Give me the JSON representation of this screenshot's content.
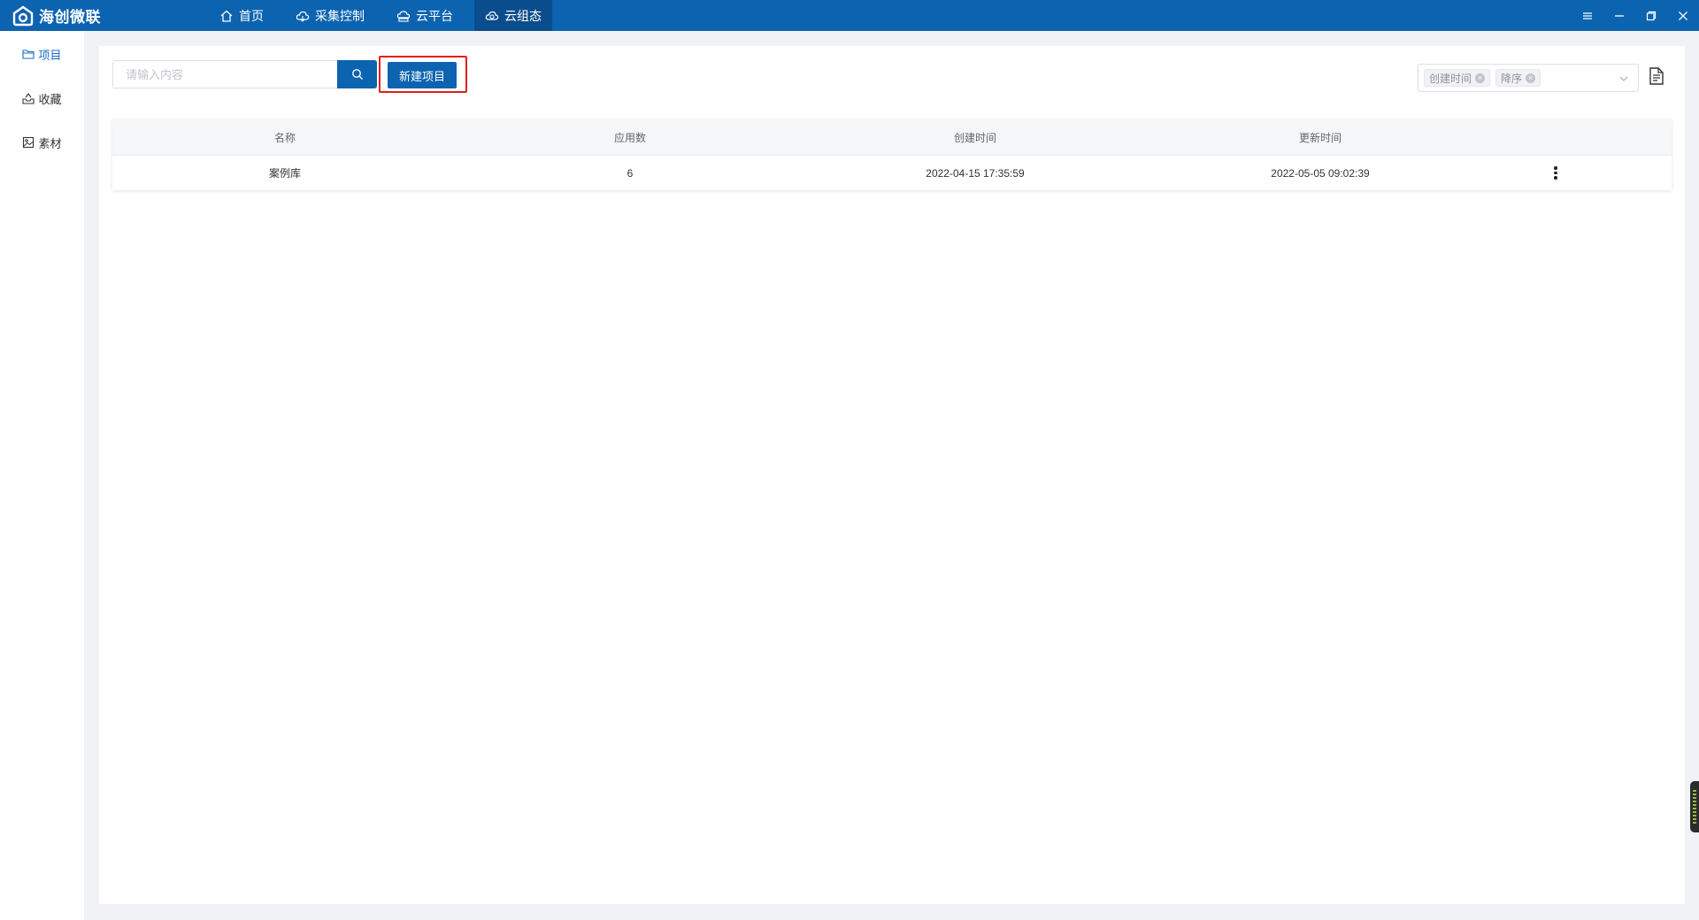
{
  "app": {
    "brand_name": "海创微联",
    "colors": {
      "primary": "#0c63b0",
      "highlight_border": "#e0201d",
      "sidebar_active": "#1a6fc7"
    }
  },
  "nav": {
    "items": [
      {
        "label": "首页",
        "icon": "home-icon"
      },
      {
        "label": "采集控制",
        "icon": "cloud-icon"
      },
      {
        "label": "云平台",
        "icon": "cloud-platform-icon"
      },
      {
        "label": "云组态",
        "icon": "cloud-config-icon",
        "active": true
      }
    ]
  },
  "window_controls": [
    "menu-icon",
    "minimize-icon",
    "restore-icon",
    "close-icon"
  ],
  "sidebar": {
    "items": [
      {
        "label": "项目",
        "icon": "folder-icon",
        "active": true
      },
      {
        "label": "收藏",
        "icon": "collect-icon"
      },
      {
        "label": "素材",
        "icon": "image-icon"
      }
    ]
  },
  "toolbar": {
    "search_placeholder": "请输入内容",
    "search_value": "",
    "new_project_label": "新建项目"
  },
  "sort": {
    "tags": [
      "创建时间",
      "降序"
    ]
  },
  "table": {
    "headers": [
      "名称",
      "应用数",
      "创建时间",
      "更新时间"
    ],
    "rows": [
      {
        "name": "案例库",
        "apps": "6",
        "created": "2022-04-15 17:35:59",
        "updated": "2022-05-05 09:02:39"
      }
    ]
  }
}
